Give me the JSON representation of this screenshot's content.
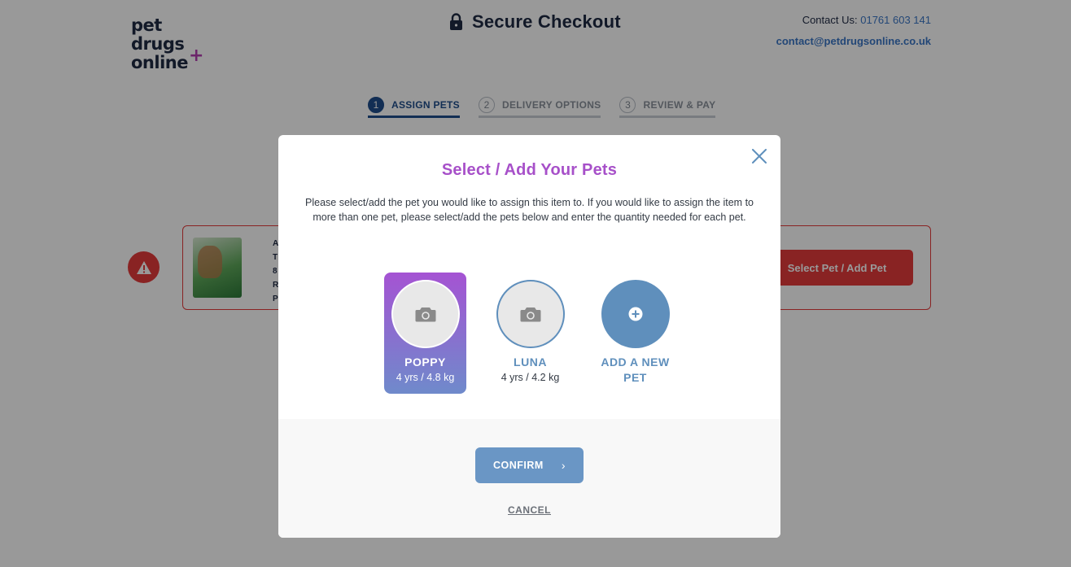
{
  "header": {
    "logo_lines": [
      "pet",
      "drugs",
      "online"
    ],
    "logo_plus": "+",
    "title": "Secure Checkout",
    "contact_label": "Contact Us:",
    "contact_phone": "01761 603 141",
    "contact_email": "contact@petdrugsonline.co.uk"
  },
  "steps": [
    {
      "number": "1",
      "label": "ASSIGN PETS",
      "active": true
    },
    {
      "number": "2",
      "label": "DELIVERY OPTIONS",
      "active": false
    },
    {
      "number": "3",
      "label": "REVIEW & PAY",
      "active": false
    }
  ],
  "item_card": {
    "text_lines": [
      "A",
      "T",
      "8",
      "R",
      "P"
    ],
    "select_button_label": "Select Pet / Add Pet"
  },
  "modal": {
    "title": "Select / Add Your Pets",
    "description": "Please select/add the pet you would like to assign this item to. If you would like to assign the item to more than one pet, please select/add the pets below and enter the quantity needed for each pet.",
    "pets": [
      {
        "name": "POPPY",
        "meta": "4 yrs / 4.8 kg",
        "selected": true
      },
      {
        "name": "LUNA",
        "meta": "4 yrs / 4.2 kg",
        "selected": false
      }
    ],
    "add_pet_line1": "ADD A NEW",
    "add_pet_line2": "PET",
    "confirm_label": "CONFIRM",
    "cancel_label": "CANCEL"
  },
  "colors": {
    "brand_navy": "#1f2a44",
    "accent_purple": "#a750c9",
    "accent_blue": "#5f8fbc",
    "error_red": "#e53b3b"
  }
}
